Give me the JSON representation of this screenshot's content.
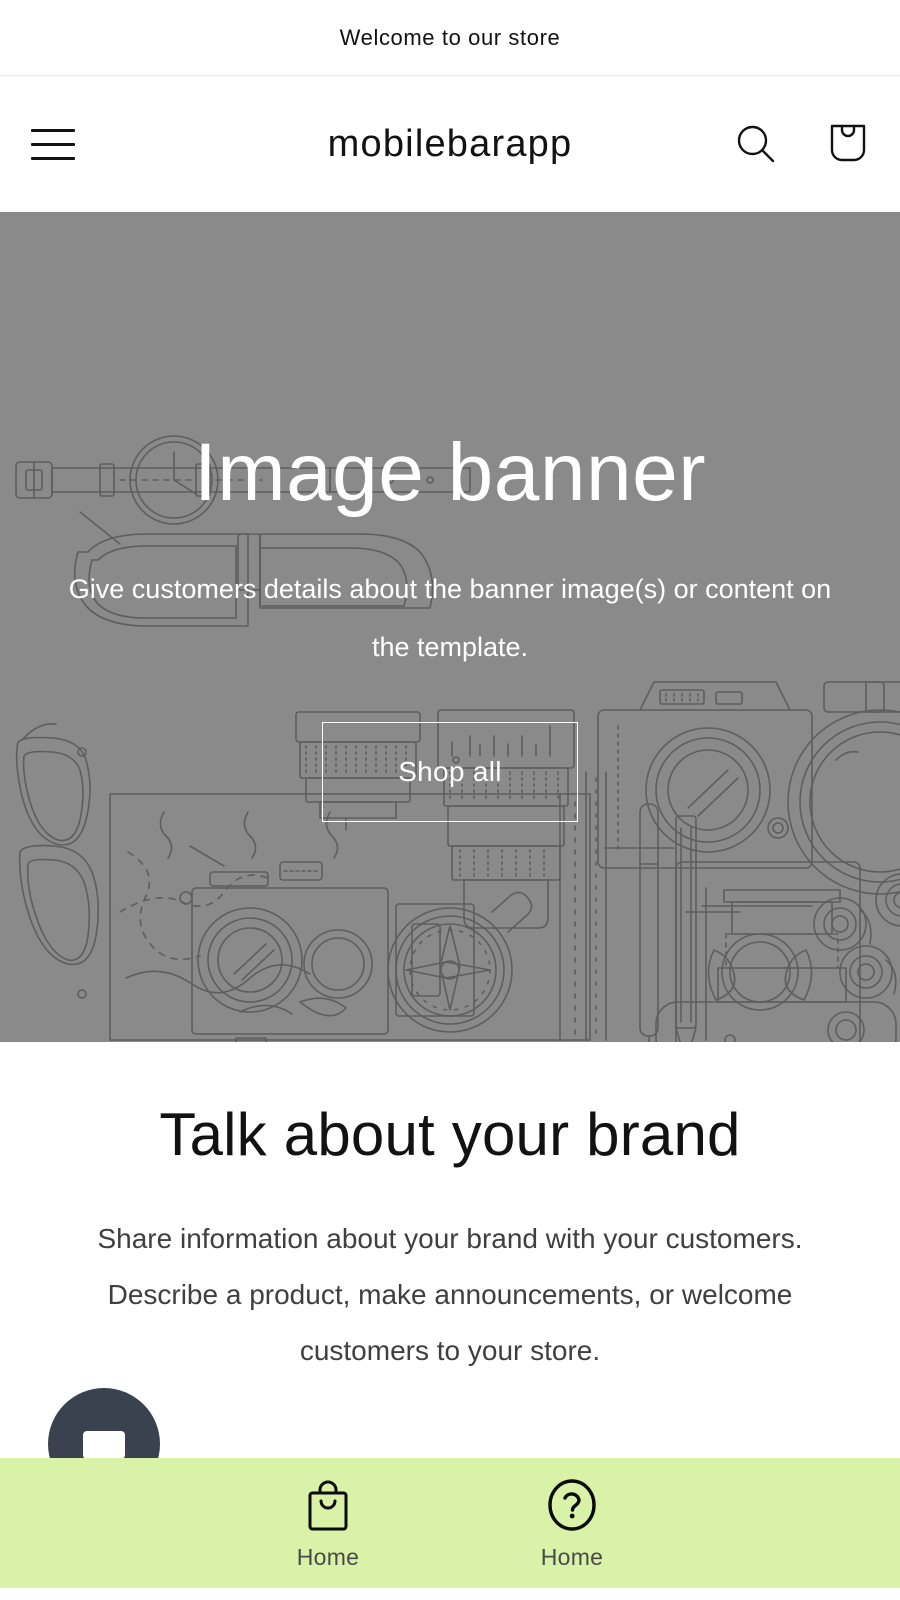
{
  "announcement": {
    "text": "Welcome to our store"
  },
  "header": {
    "logo": "mobilebarapp",
    "menu_icon": "hamburger-icon",
    "search_icon": "search-icon",
    "cart_icon": "shopping-bag-icon"
  },
  "banner": {
    "heading": "Image banner",
    "subheading": "Give customers details about the banner image(s) or content on the template.",
    "cta_label": "Shop all",
    "background_color": "#8a8a8a",
    "text_color": "#ffffff",
    "illustration": "flat-lay-photography-travel-items"
  },
  "brand_section": {
    "heading": "Talk about your brand",
    "body": "Share information about your brand with your customers. Describe a product, make announcements, or welcome customers to your store."
  },
  "chat": {
    "icon": "chat-bubble-icon",
    "color": "#3a4250"
  },
  "bottom_bar": {
    "background_color": "#d8f2a8",
    "tabs": [
      {
        "label": "Home",
        "icon": "shopping-bag-icon"
      },
      {
        "label": "Home",
        "icon": "question-circle-icon"
      }
    ]
  }
}
